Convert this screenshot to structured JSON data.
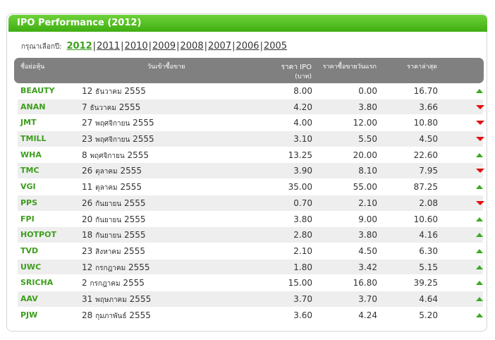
{
  "title": "IPO Performance (2012)",
  "year_selector": {
    "label": "กรุณาเลือกปี:",
    "selected": "2012",
    "years": [
      "2011",
      "2010",
      "2009",
      "2008",
      "2007",
      "2006",
      "2005"
    ]
  },
  "headers": {
    "symbol": "ชื่อย่อหุ้น",
    "date": "วันเข้าซื้อขาย",
    "ipo_price": "ราคา IPO",
    "ipo_unit": "(บาท)",
    "first_day": "ราคาซื้อขายวันแรก",
    "last": "ราคาล่าสุด"
  },
  "colors": {
    "accent": "#3c9e1c",
    "up": "#3aab22",
    "down": "#e01010",
    "header_bg": "#808080"
  },
  "rows": [
    {
      "symbol": "BEAUTY",
      "day": "12",
      "month": "ธันวาคม",
      "year": "2555",
      "ipo": "8.00",
      "first": "0.00",
      "last": "16.70",
      "trend": "up"
    },
    {
      "symbol": "ANAN",
      "day": "7",
      "month": "ธันวาคม",
      "year": "2555",
      "ipo": "4.20",
      "first": "3.80",
      "last": "3.66",
      "trend": "down"
    },
    {
      "symbol": "JMT",
      "day": "27",
      "month": "พฤศจิกายน",
      "year": "2555",
      "ipo": "4.00",
      "first": "12.00",
      "last": "10.80",
      "trend": "down"
    },
    {
      "symbol": "TMILL",
      "day": "23",
      "month": "พฤศจิกายน",
      "year": "2555",
      "ipo": "3.10",
      "first": "5.50",
      "last": "4.50",
      "trend": "down"
    },
    {
      "symbol": "WHA",
      "day": "8",
      "month": "พฤศจิกายน",
      "year": "2555",
      "ipo": "13.25",
      "first": "20.00",
      "last": "22.60",
      "trend": "up"
    },
    {
      "symbol": "TMC",
      "day": "26",
      "month": "ตุลาคม",
      "year": "2555",
      "ipo": "3.90",
      "first": "8.10",
      "last": "7.95",
      "trend": "down"
    },
    {
      "symbol": "VGI",
      "day": "11",
      "month": "ตุลาคม",
      "year": "2555",
      "ipo": "35.00",
      "first": "55.00",
      "last": "87.25",
      "trend": "up"
    },
    {
      "symbol": "PPS",
      "day": "26",
      "month": "กันยายน",
      "year": "2555",
      "ipo": "0.70",
      "first": "2.10",
      "last": "2.08",
      "trend": "down"
    },
    {
      "symbol": "FPI",
      "day": "20",
      "month": "กันยายน",
      "year": "2555",
      "ipo": "3.80",
      "first": "9.00",
      "last": "10.60",
      "trend": "up"
    },
    {
      "symbol": "HOTPOT",
      "day": "18",
      "month": "กันยายน",
      "year": "2555",
      "ipo": "2.80",
      "first": "3.80",
      "last": "4.16",
      "trend": "up"
    },
    {
      "symbol": "TVD",
      "day": "23",
      "month": "สิงหาคม",
      "year": "2555",
      "ipo": "2.10",
      "first": "4.50",
      "last": "6.30",
      "trend": "up"
    },
    {
      "symbol": "UWC",
      "day": "12",
      "month": "กรกฎาคม",
      "year": "2555",
      "ipo": "1.80",
      "first": "3.42",
      "last": "5.15",
      "trend": "up"
    },
    {
      "symbol": "SRICHA",
      "day": "2",
      "month": "กรกฎาคม",
      "year": "2555",
      "ipo": "15.00",
      "first": "16.80",
      "last": "39.25",
      "trend": "up"
    },
    {
      "symbol": "AAV",
      "day": "31",
      "month": "พฤษภาคม",
      "year": "2555",
      "ipo": "3.70",
      "first": "3.70",
      "last": "4.64",
      "trend": "up"
    },
    {
      "symbol": "PJW",
      "day": "28",
      "month": "กุมภาพันธ์",
      "year": "2555",
      "ipo": "3.60",
      "first": "4.24",
      "last": "5.20",
      "trend": "up"
    }
  ]
}
